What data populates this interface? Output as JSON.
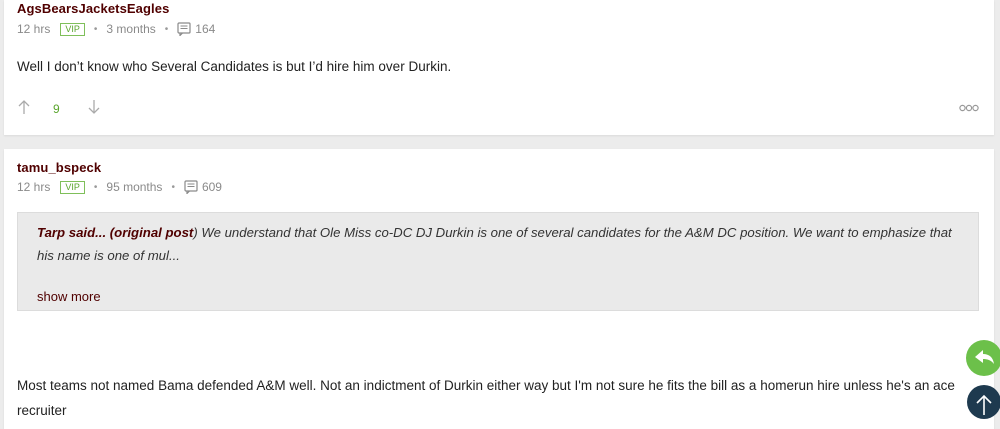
{
  "posts": [
    {
      "username": "AgsBearsJacketsEagles",
      "time": "12 hrs",
      "badge": "VIP",
      "tenure": "3 months",
      "post_count": "164",
      "body": "Well I don’t know who Several Candidates is but I’d hire him over Durkin.",
      "votes": "9"
    },
    {
      "username": "tamu_bspeck",
      "time": "12 hrs",
      "badge": "VIP",
      "tenure": "95 months",
      "post_count": "609",
      "quote": {
        "author": "Tarp said... (original post",
        "paren_close": ")",
        "text": " We understand that Ole Miss co-DC DJ Durkin is one of several candidates for the A&M DC position. We want to emphasize that his name is one of mul...",
        "show_more": "show more"
      },
      "body_line1": "Most teams not named Bama defended A&M well. Not an indictment of Durkin either way but I'm not sure he fits the bill as a homerun hire unless he's an ace",
      "body_line2": "recruiter"
    }
  ],
  "icons": {
    "comments": "comments-icon",
    "upvote": "arrow-up-icon",
    "downvote": "arrow-down-icon",
    "more": "more-options-icon",
    "reply": "reply-icon",
    "scroll_top": "arrow-up-icon"
  },
  "colors": {
    "username": "#500000",
    "vip": "#5aa52d",
    "vote_count": "#5aa52d",
    "reply_fab": "#6cc04a",
    "top_fab": "#1e3a4f"
  }
}
